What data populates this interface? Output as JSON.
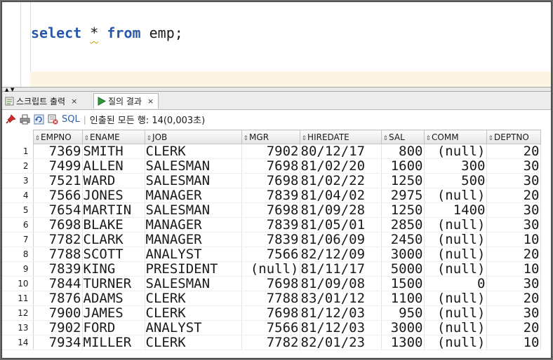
{
  "editor": {
    "kw_select": "select",
    "star": "*",
    "kw_from": "from",
    "table": "emp;"
  },
  "tabs": [
    {
      "label": "스크립트 출력",
      "close": "×"
    },
    {
      "label": "질의 결과",
      "close": "×"
    }
  ],
  "toolbar": {
    "sql_label": "SQL",
    "separator": "|",
    "status": "인출된 모든 행: 14(0,003초)"
  },
  "grid": {
    "columns": [
      "EMPNO",
      "ENAME",
      "JOB",
      "MGR",
      "HIREDATE",
      "SAL",
      "COMM",
      "DEPTNO"
    ],
    "rows": [
      [
        "1",
        "7369",
        "SMITH",
        "CLERK",
        "7902",
        "80/12/17",
        "800",
        "(null)",
        "20"
      ],
      [
        "2",
        "7499",
        "ALLEN",
        "SALESMAN",
        "7698",
        "81/02/20",
        "1600",
        "300",
        "30"
      ],
      [
        "3",
        "7521",
        "WARD",
        "SALESMAN",
        "7698",
        "81/02/22",
        "1250",
        "500",
        "30"
      ],
      [
        "4",
        "7566",
        "JONES",
        "MANAGER",
        "7839",
        "81/04/02",
        "2975",
        "(null)",
        "20"
      ],
      [
        "5",
        "7654",
        "MARTIN",
        "SALESMAN",
        "7698",
        "81/09/28",
        "1250",
        "1400",
        "30"
      ],
      [
        "6",
        "7698",
        "BLAKE",
        "MANAGER",
        "7839",
        "81/05/01",
        "2850",
        "(null)",
        "30"
      ],
      [
        "7",
        "7782",
        "CLARK",
        "MANAGER",
        "7839",
        "81/06/09",
        "2450",
        "(null)",
        "10"
      ],
      [
        "8",
        "7788",
        "SCOTT",
        "ANALYST",
        "7566",
        "82/12/09",
        "3000",
        "(null)",
        "20"
      ],
      [
        "9",
        "7839",
        "KING",
        "PRESIDENT",
        "(null)",
        "81/11/17",
        "5000",
        "(null)",
        "10"
      ],
      [
        "10",
        "7844",
        "TURNER",
        "SALESMAN",
        "7698",
        "81/09/08",
        "1500",
        "0",
        "30"
      ],
      [
        "11",
        "7876",
        "ADAMS",
        "CLERK",
        "7788",
        "83/01/12",
        "1100",
        "(null)",
        "20"
      ],
      [
        "12",
        "7900",
        "JAMES",
        "CLERK",
        "7698",
        "81/12/03",
        "950",
        "(null)",
        "30"
      ],
      [
        "13",
        "7902",
        "FORD",
        "ANALYST",
        "7566",
        "81/12/03",
        "3000",
        "(null)",
        "20"
      ],
      [
        "14",
        "7934",
        "MILLER",
        "CLERK",
        "7782",
        "82/01/23",
        "1300",
        "(null)",
        "10"
      ]
    ]
  },
  "colors": {
    "keyword": "#2a58a8",
    "current_line": "#fdf5e4",
    "link": "#3060a8"
  }
}
